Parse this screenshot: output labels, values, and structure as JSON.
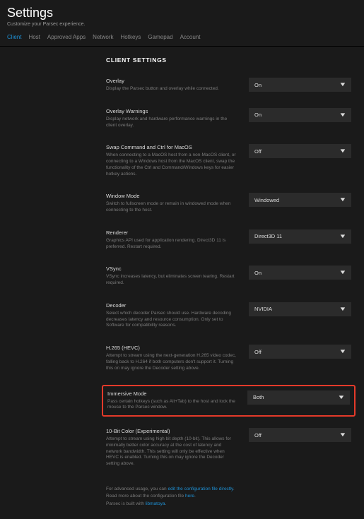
{
  "header": {
    "title": "Settings",
    "subtitle": "Customize your Parsec experience."
  },
  "tabs": [
    {
      "label": "Client",
      "active": true
    },
    {
      "label": "Host",
      "active": false
    },
    {
      "label": "Approved Apps",
      "active": false
    },
    {
      "label": "Network",
      "active": false
    },
    {
      "label": "Hotkeys",
      "active": false
    },
    {
      "label": "Gamepad",
      "active": false
    },
    {
      "label": "Account",
      "active": false
    }
  ],
  "section_title": "CLIENT SETTINGS",
  "settings": [
    {
      "key": "overlay",
      "title": "Overlay",
      "desc": "Display the Parsec button and overlay while connected.",
      "value": "On",
      "highlight": false
    },
    {
      "key": "overlay_warnings",
      "title": "Overlay Warnings",
      "desc": "Display network and hardware performance warnings in the client overlay.",
      "value": "On",
      "highlight": false
    },
    {
      "key": "swap_cmd_ctrl",
      "title": "Swap Command and Ctrl for MacOS",
      "desc": "When connecting to a MacOS host from a non-MacOS client, or connecting to a Windows host from the MacOS client, swap the functionality of the Ctrl and Command/Windows keys for easier hotkey actions.",
      "value": "Off",
      "highlight": false
    },
    {
      "key": "window_mode",
      "title": "Window Mode",
      "desc": "Switch to fullscreen mode or remain in windowed mode when connecting to the host.",
      "value": "Windowed",
      "highlight": false
    },
    {
      "key": "renderer",
      "title": "Renderer",
      "desc": "Graphics API used for application rendering. Direct3D 11 is preferred. Restart required.",
      "value": "Direct3D 11",
      "highlight": false
    },
    {
      "key": "vsync",
      "title": "VSync",
      "desc": "VSync increases latency, but eliminates screen tearing. Restart required.",
      "value": "On",
      "highlight": false
    },
    {
      "key": "decoder",
      "title": "Decoder",
      "desc": "Select which decoder Parsec should use. Hardware decoding decreases latency and resource consumption. Only set to Software for compatibility reasons.",
      "value": "NVIDIA",
      "highlight": false
    },
    {
      "key": "hevc",
      "title": "H.265 (HEVC)",
      "desc": "Attempt to stream using the next-generation H.265 video codec, falling back to H.264 if both computers don't support it. Turning this on may ignore the Decoder setting above.",
      "value": "Off",
      "highlight": false
    },
    {
      "key": "immersive",
      "title": "Immersive Mode",
      "desc": "Pass certain hotkeys (such as Alt+Tab) to the host and lock the mouse to the Parsec window.",
      "value": "Both",
      "highlight": true
    },
    {
      "key": "ten_bit",
      "title": "10-Bit Color (Experimental)",
      "desc": "Attempt to stream using high bit depth (10-bit). This allows for minimally better color accuracy at the cost of latency and network bandwidth. This setting will only be effective when HEVC is enabled. Turning this on may ignore the Decoder setting above.",
      "value": "Off",
      "highlight": false
    }
  ],
  "footer": {
    "line1_a": "For advanced usage, you can ",
    "line1_link": "edit the configuration file directly",
    "line1_b": ".",
    "line2_a": "Read more about the configuration file ",
    "line2_link": "here",
    "line2_b": ".",
    "line3_a": "Parsec is built with ",
    "line3_link": "libmatoya",
    "line3_b": "."
  }
}
